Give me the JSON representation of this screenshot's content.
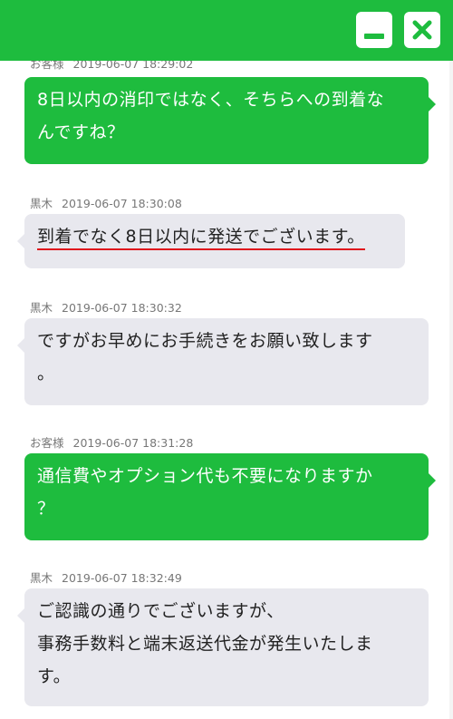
{
  "header": {
    "minimize_icon": "minimize-icon",
    "close_icon": "close-icon",
    "accent": "#1ebc3e"
  },
  "messages": [
    {
      "sender": "お客様",
      "time": "2019-06-07 18:29:02",
      "direction": "out",
      "lines": [
        "8日以内の消印ではなく、そちらへの到着な",
        "んですね？"
      ]
    },
    {
      "sender": "黒木",
      "time": "2019-06-07 18:30:08",
      "direction": "in",
      "lines": [
        "到着でなく8日以内に発送でございます。"
      ],
      "underline_color": "#e0161c"
    },
    {
      "sender": "黒木",
      "time": "2019-06-07 18:30:32",
      "direction": "in",
      "lines": [
        "ですがお早めにお手続きをお願い致します",
        "。"
      ]
    },
    {
      "sender": "お客様",
      "time": "2019-06-07 18:31:28",
      "direction": "out",
      "lines": [
        "通信費やオプション代も不要になりますか",
        "？"
      ]
    },
    {
      "sender": "黒木",
      "time": "2019-06-07 18:32:49",
      "direction": "in",
      "lines": [
        "ご認識の通りでございますが、",
        "事務手数料と端末返送代金が発生いたしま",
        "す。"
      ]
    }
  ],
  "colors": {
    "incoming_bubble": "#e8e8ee",
    "outgoing_bubble": "#1ebc3e"
  }
}
